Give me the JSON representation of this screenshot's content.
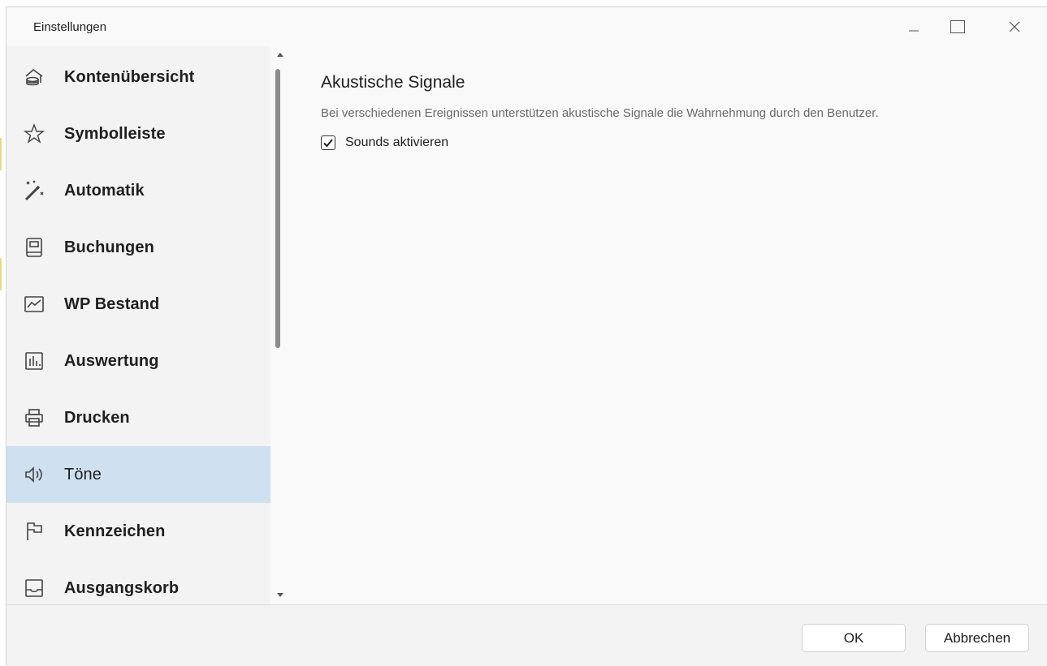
{
  "window": {
    "title": "Einstellungen",
    "controls": {
      "minimize": "—",
      "maximize": "☐",
      "close": "✕"
    }
  },
  "sidebar": {
    "items": [
      {
        "label": "Kontenübersicht",
        "icon": "account-overview-icon",
        "selected": false
      },
      {
        "label": "Symbolleiste",
        "icon": "star-icon",
        "selected": false
      },
      {
        "label": "Automatik",
        "icon": "magic-wand-icon",
        "selected": false
      },
      {
        "label": "Buchungen",
        "icon": "ledger-book-icon",
        "selected": false
      },
      {
        "label": "WP Bestand",
        "icon": "stock-chart-icon",
        "selected": false
      },
      {
        "label": "Auswertung",
        "icon": "bar-chart-icon",
        "selected": false
      },
      {
        "label": "Drucken",
        "icon": "printer-icon",
        "selected": false
      },
      {
        "label": "Töne",
        "icon": "speaker-icon",
        "selected": true
      },
      {
        "label": "Kennzeichen",
        "icon": "flag-icon",
        "selected": false
      },
      {
        "label": "Ausgangskorb",
        "icon": "outbox-tray-icon",
        "selected": false
      }
    ]
  },
  "content": {
    "title": "Akustische Signale",
    "description": "Bei verschiedenen Ereignissen unterstützen akustische Signale die Wahrnehmung durch den Benutzer.",
    "checkbox": {
      "label": "Sounds aktivieren",
      "checked": true
    }
  },
  "footer": {
    "ok_label": "OK",
    "cancel_label": "Abbrechen"
  },
  "colors": {
    "selected_bg": "#cfe0f1",
    "sidebar_bg": "#f3f3f3",
    "content_bg": "#f9f9f9"
  }
}
